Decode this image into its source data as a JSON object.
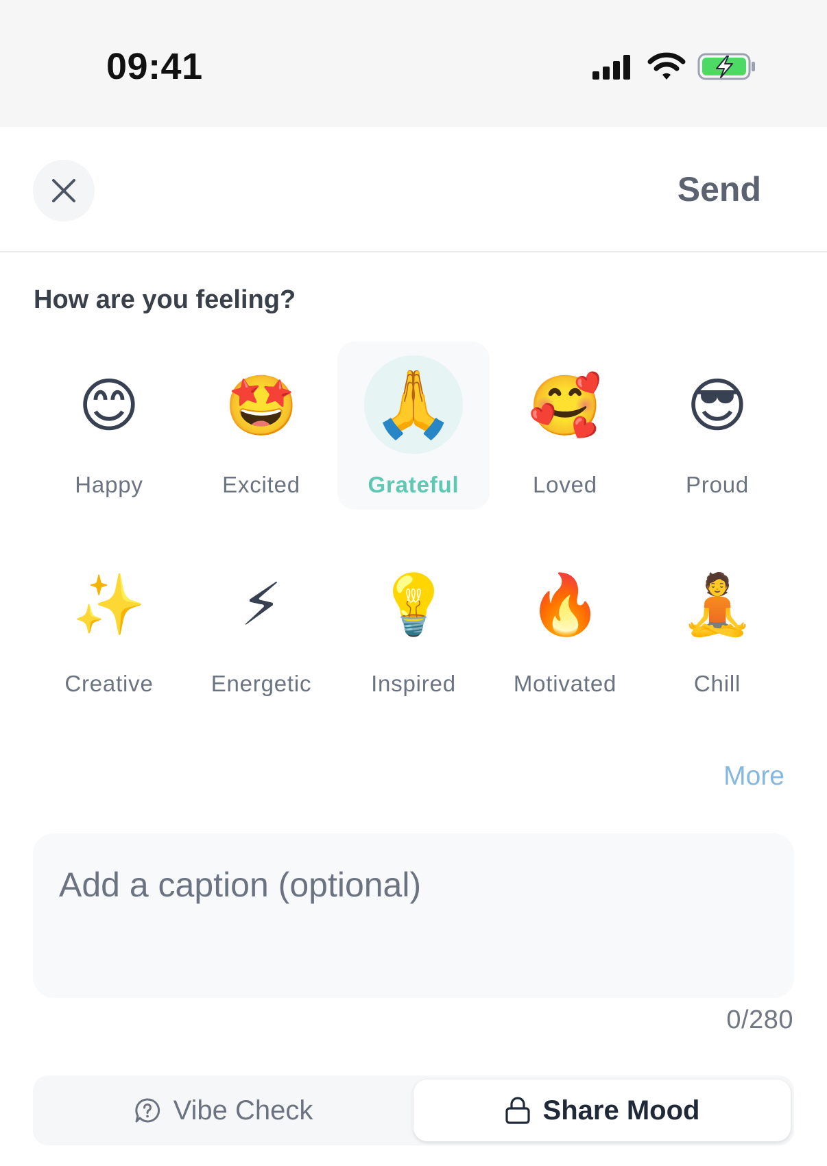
{
  "status_bar": {
    "time": "09:41",
    "icons": [
      "signal-icon",
      "wifi-icon",
      "battery-charging-icon"
    ],
    "battery_color": "#4cd964"
  },
  "header": {
    "close_icon": "close-icon",
    "send_label": "Send"
  },
  "prompt": "How are you feeling?",
  "moods": [
    {
      "emoji": "😊",
      "label": "Happy",
      "selected": false
    },
    {
      "emoji": "🤩",
      "label": "Excited",
      "selected": false
    },
    {
      "emoji": "🙏",
      "label": "Grateful",
      "selected": true
    },
    {
      "emoji": "🥰",
      "label": "Loved",
      "selected": false
    },
    {
      "emoji": "😎",
      "label": "Proud",
      "selected": false
    },
    {
      "emoji": "✨",
      "label": "Creative",
      "selected": false
    },
    {
      "emoji": "⚡",
      "label": "Energetic",
      "selected": false
    },
    {
      "emoji": "💡",
      "label": "Inspired",
      "selected": false
    },
    {
      "emoji": "🔥",
      "label": "Motivated",
      "selected": false
    },
    {
      "emoji": "🧘",
      "label": "Chill",
      "selected": false
    }
  ],
  "more_label": "More",
  "caption": {
    "placeholder": "Add a caption (optional)",
    "value": "",
    "count": "0/280"
  },
  "tabs": {
    "vibe_check": {
      "label": "Vibe Check",
      "icon": "chat-question-icon",
      "active": false
    },
    "share_mood": {
      "label": "Share Mood",
      "icon": "lock-icon",
      "active": true
    }
  },
  "colors": {
    "accent": "#5ec8b3",
    "link": "#86b7e0",
    "selected_bg": "#e6f5f3"
  }
}
